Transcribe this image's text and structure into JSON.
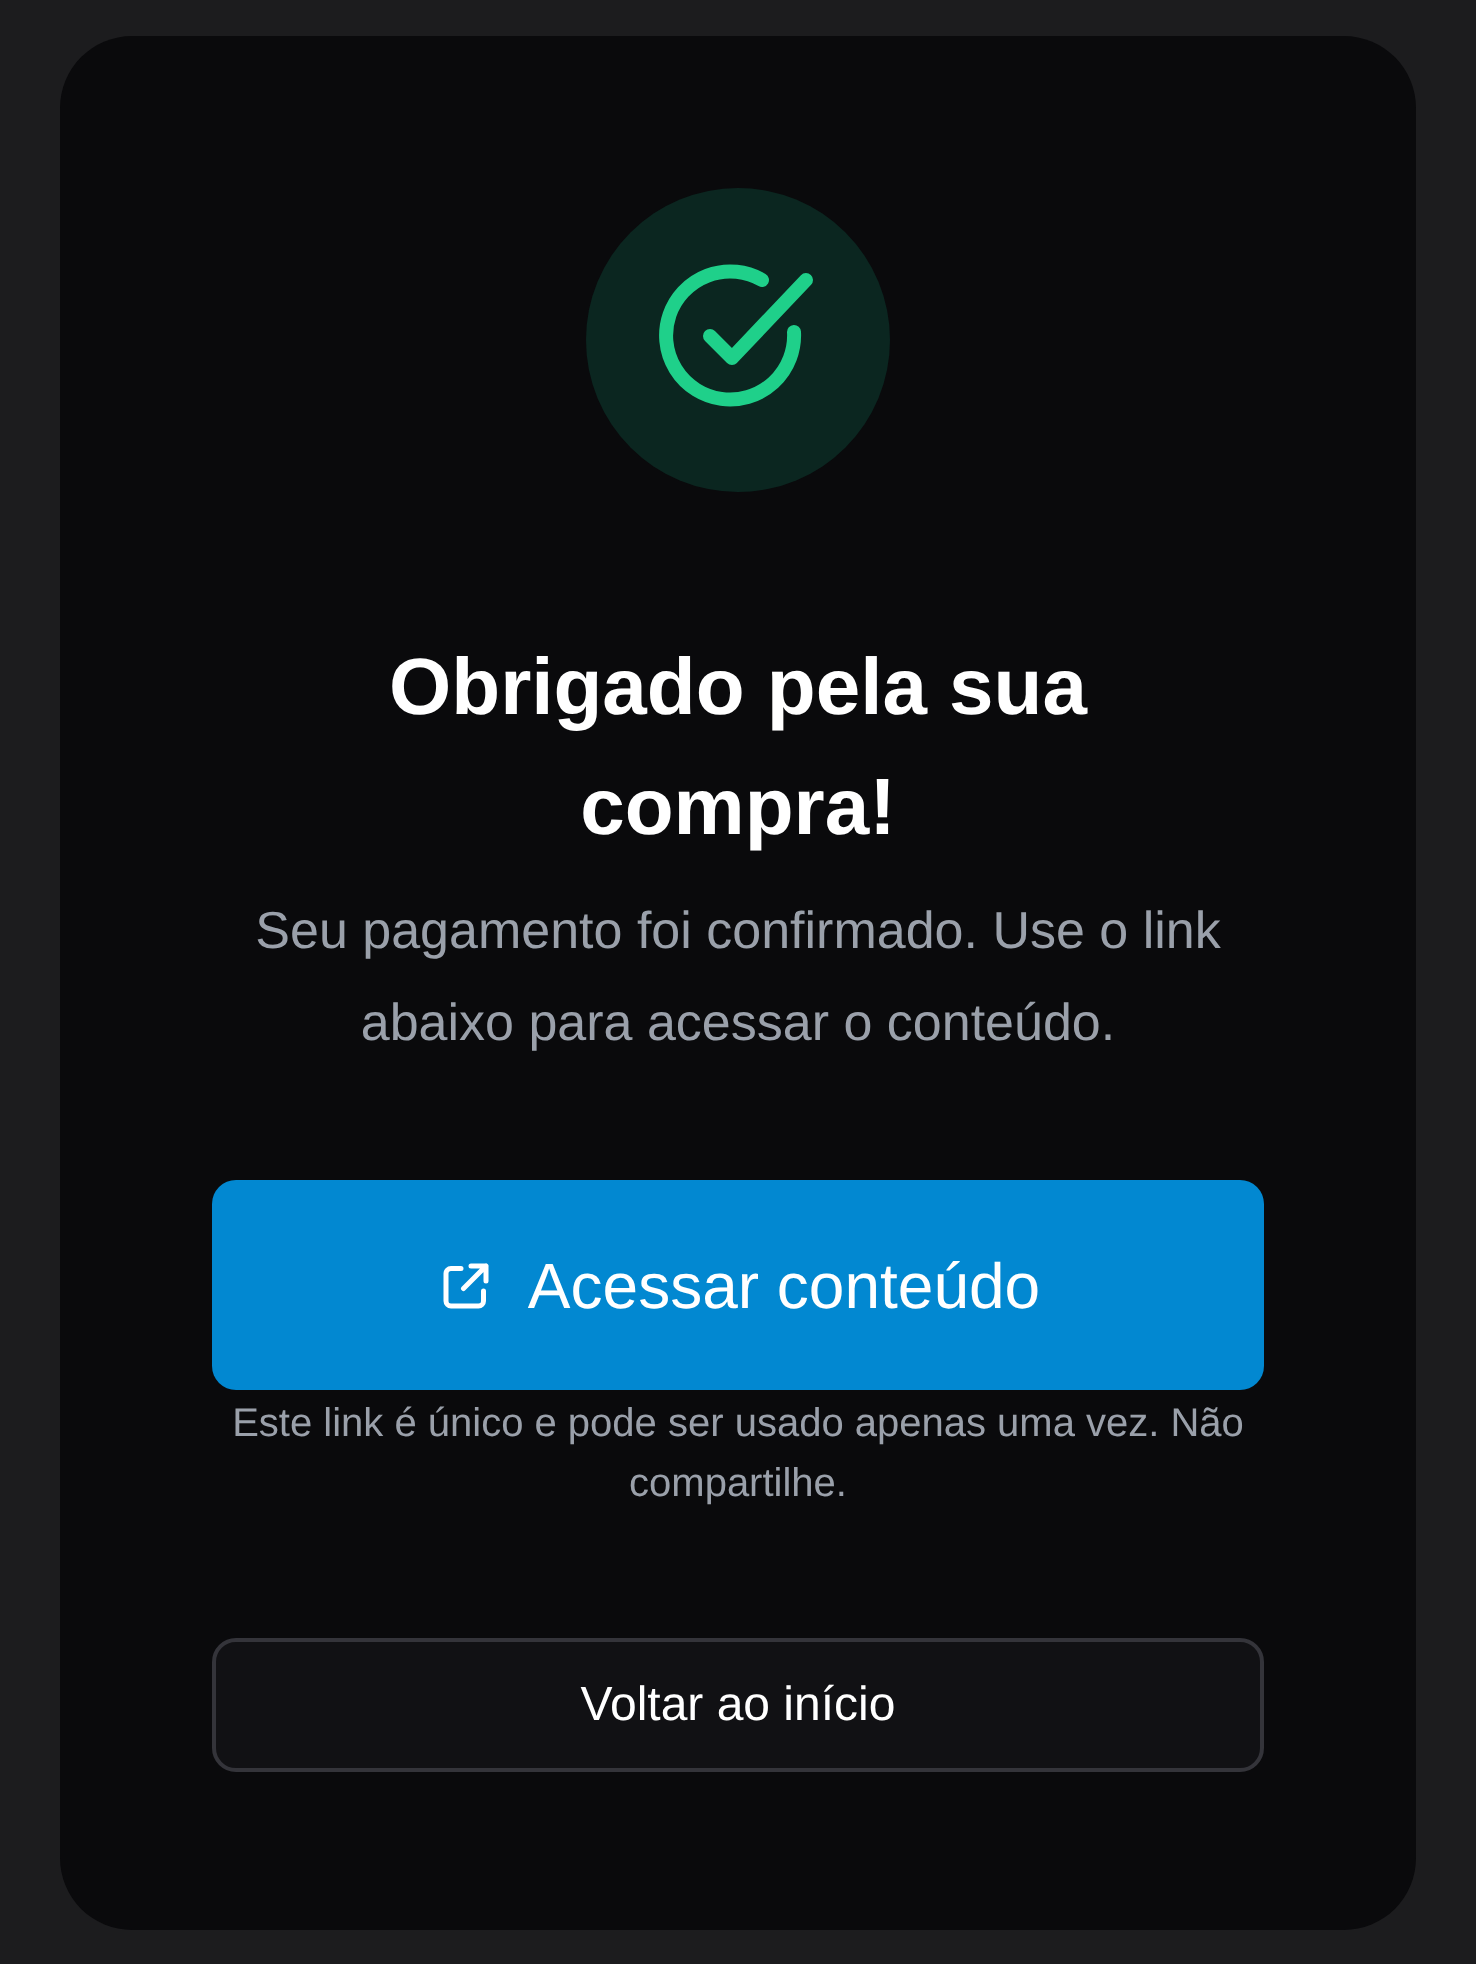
{
  "title": "Obrigado pela sua compra!",
  "message": "Seu pagamento foi confirmado. Use o link abaixo para acessar o conteúdo.",
  "primary_button": {
    "label": "Acessar conteúdo"
  },
  "note": "Este link é único e pode ser usado apenas uma vez. Não compartilhe.",
  "secondary_button": {
    "label": "Voltar ao início"
  }
}
